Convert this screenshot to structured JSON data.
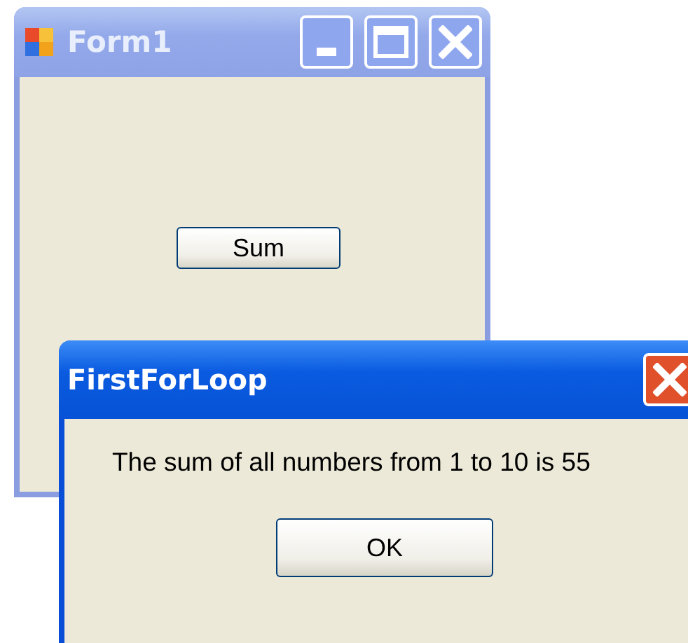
{
  "form": {
    "title": "Form1",
    "active": false,
    "button": "Sum"
  },
  "dialog": {
    "title": "FirstForLoop",
    "active": true,
    "message": "The sum of all numbers from 1 to 10 is 55",
    "button": "OK"
  }
}
